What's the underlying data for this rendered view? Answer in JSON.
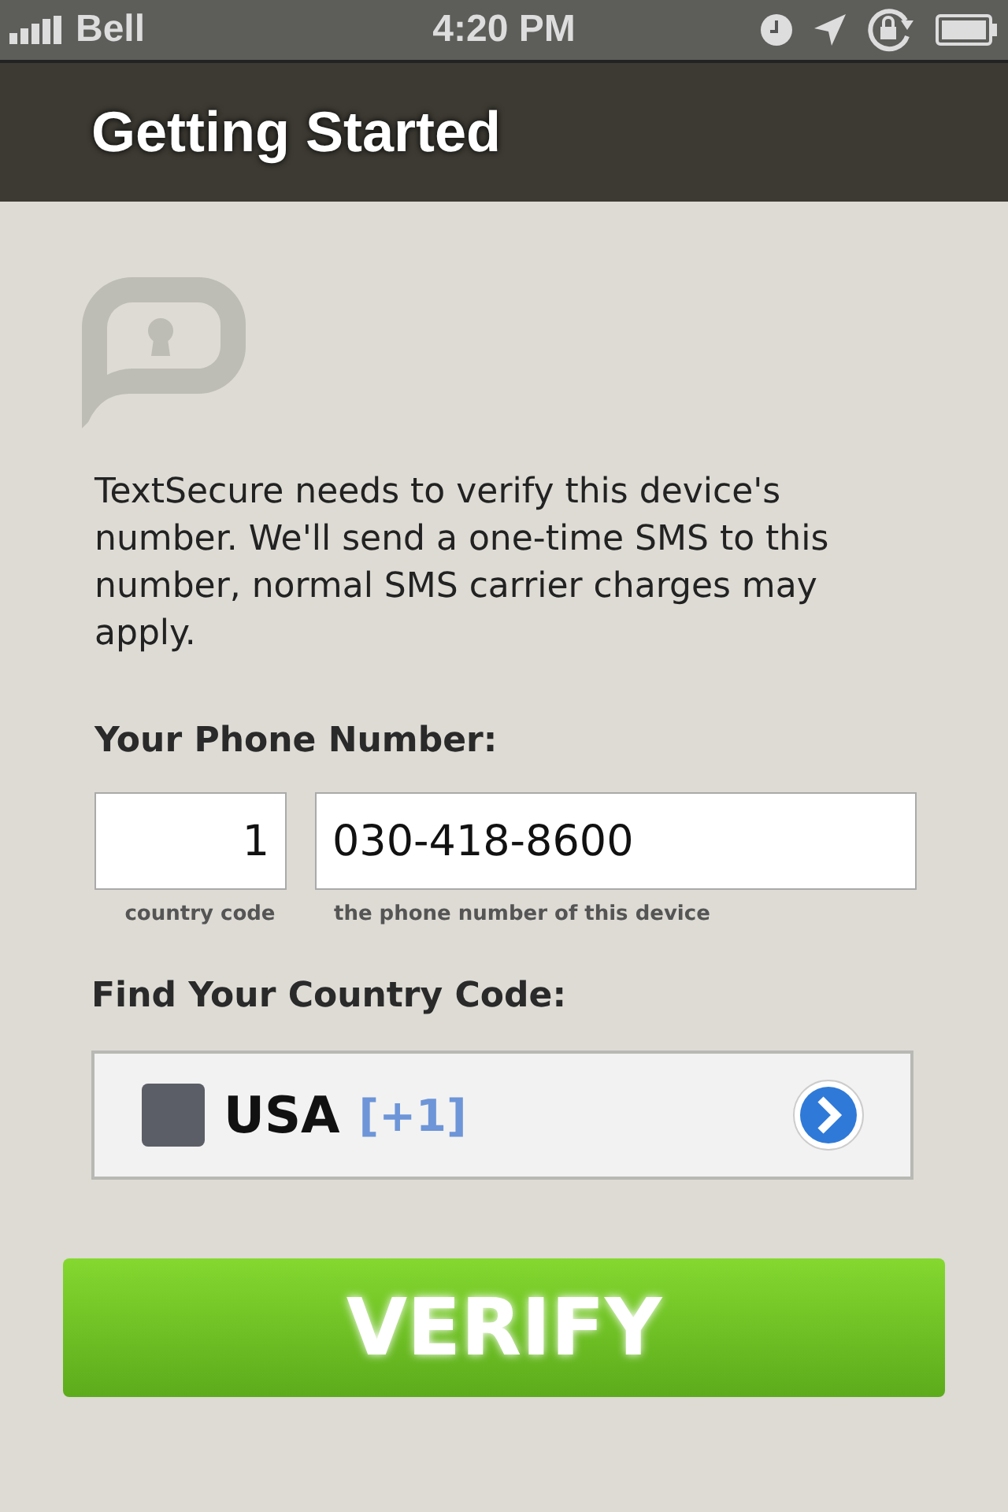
{
  "status_bar": {
    "carrier": "Bell",
    "time": "4:20 PM"
  },
  "nav_bar": {
    "title": "Getting Started"
  },
  "intro": "TextSecure needs to verify this device's number. We'll send a one-time SMS to this number, normal SMS carrier charges may apply.",
  "phone_section": {
    "heading": "Your Phone Number:",
    "country_code": {
      "value": "1",
      "caption": "country code"
    },
    "phone_number": {
      "value": "030-418-8600",
      "caption": "the phone number of this device"
    }
  },
  "country_section": {
    "heading": "Find Your Country Code:",
    "country": "USA",
    "code": "[+1]"
  },
  "verify_button": "VERIFY"
}
